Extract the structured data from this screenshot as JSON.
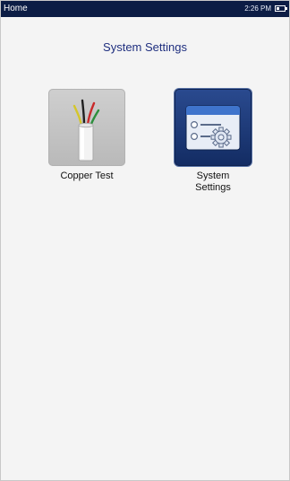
{
  "status_bar": {
    "title": "Home",
    "time": "2:26 PM",
    "battery_level": 0.35
  },
  "page": {
    "title": "System Settings"
  },
  "apps": [
    {
      "label": "Copper Test",
      "icon": "copper-cable-icon"
    },
    {
      "label": "System\nSettings",
      "icon": "system-settings-icon"
    }
  ],
  "colors": {
    "status_bar_bg": "#0c1d45",
    "title_text": "#1f2f7f",
    "settings_icon_bg": "#1b3a7a"
  }
}
